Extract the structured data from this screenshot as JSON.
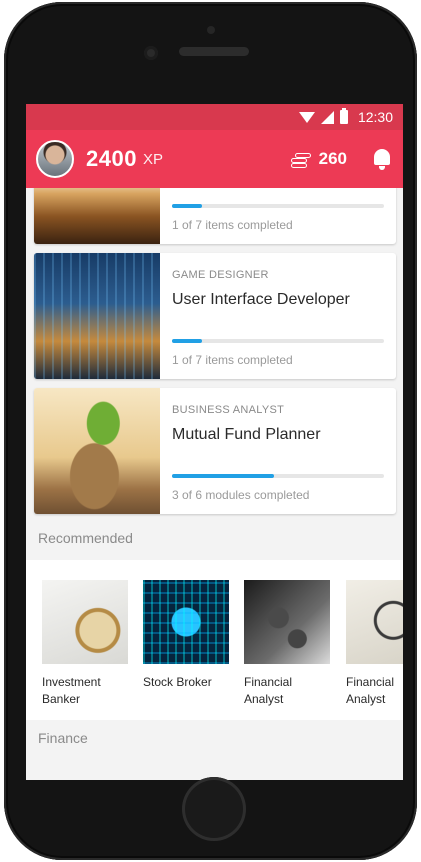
{
  "status_bar": {
    "time": "12:30"
  },
  "header": {
    "xp_value": "2400",
    "xp_unit": "XP",
    "coins": "260"
  },
  "courses": [
    {
      "category": "",
      "title": "",
      "progress_text": "1 of 7 items completed",
      "progress": 0.14
    },
    {
      "category": "GAME DESIGNER",
      "title": "User Interface Developer",
      "progress_text": "1 of 7 items completed",
      "progress": 0.14
    },
    {
      "category": "BUSINESS ANALYST",
      "title": "Mutual Fund Planner",
      "progress_text": "3 of 6 modules completed",
      "progress": 0.48
    }
  ],
  "recommended": {
    "title": "Recommended",
    "items": [
      {
        "label_line1": "Investment",
        "label_line2": "Banker"
      },
      {
        "label_line1": "Stock Broker",
        "label_line2": ""
      },
      {
        "label_line1": "Financial",
        "label_line2": "Analyst"
      },
      {
        "label_line1": "Financial",
        "label_line2": "Analyst"
      }
    ]
  },
  "finance": {
    "title": "Finance"
  },
  "colors": {
    "appbar": "#ed3a55",
    "statusbar": "#d8394e",
    "progress": "#21a0e5"
  }
}
